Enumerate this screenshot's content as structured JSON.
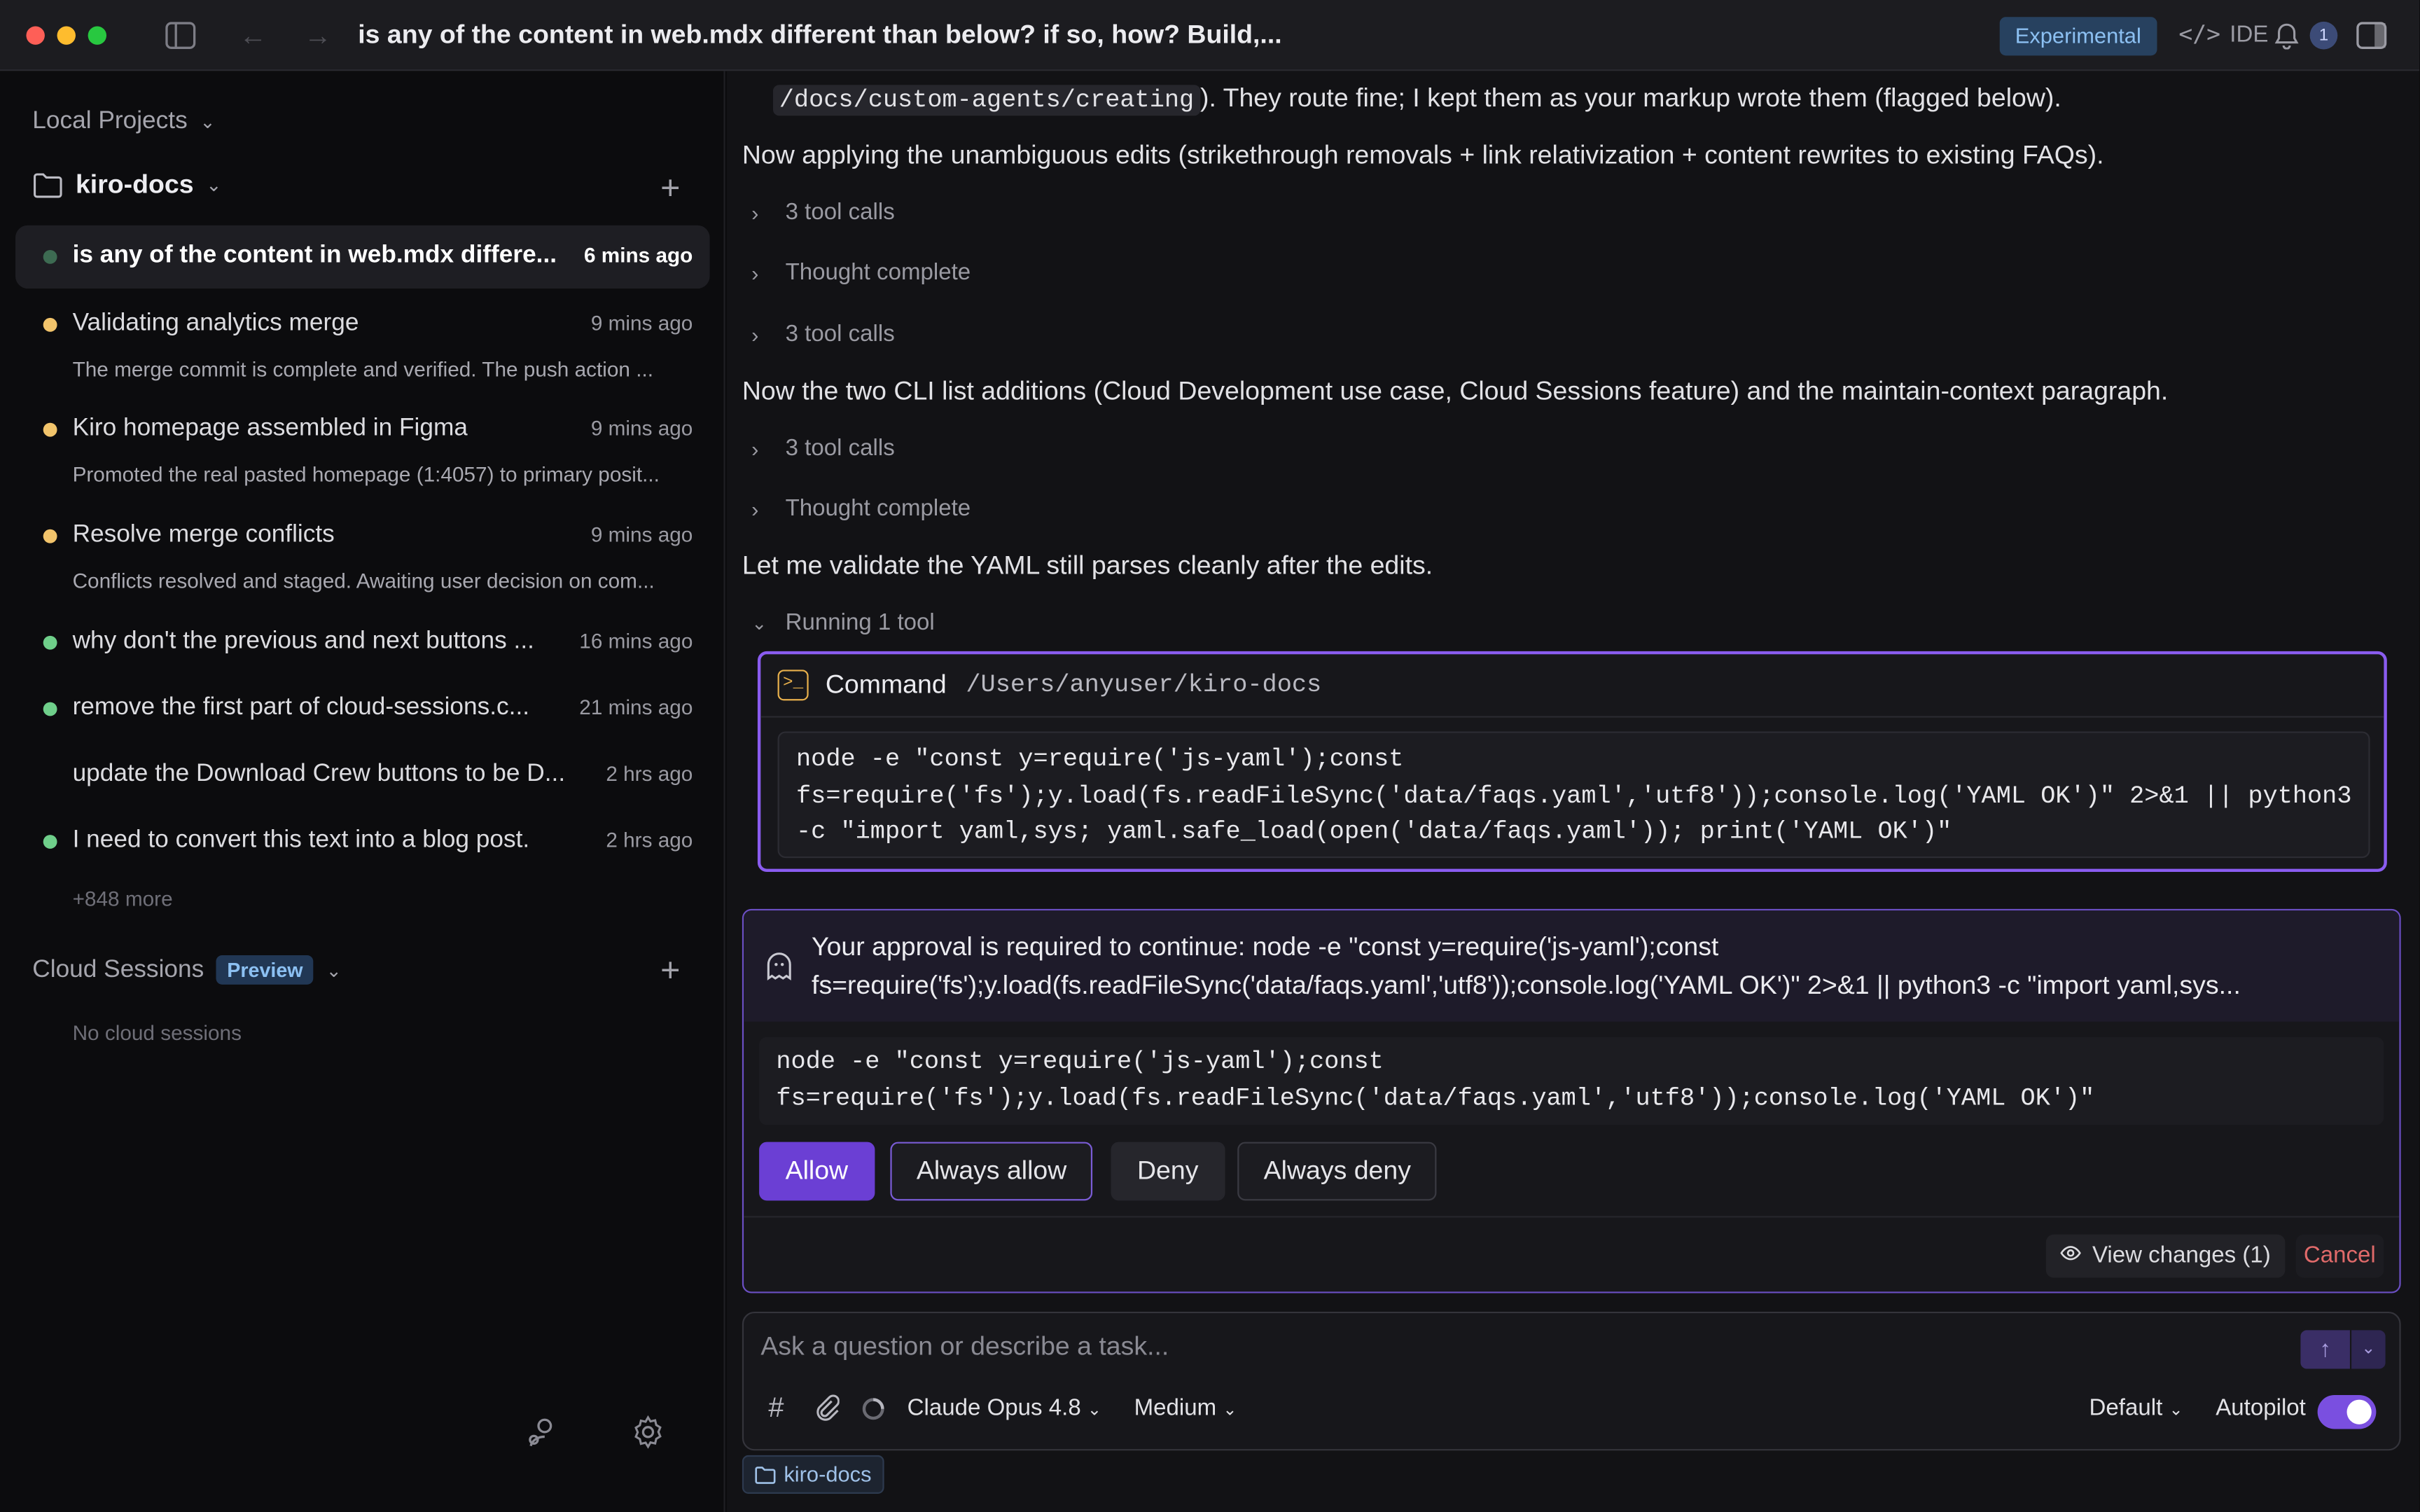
{
  "window": {
    "title": "is any of the content in web.mdx different than below? if so, how? Build,...",
    "experimental_badge": "Experimental",
    "ide_label": "IDE",
    "notification_count": "1"
  },
  "sidebar": {
    "local_projects": "Local Projects",
    "project_name": "kiro-docs",
    "sessions": [
      {
        "title": "is any of the content in web.mdx differe...",
        "time": "6 mins ago",
        "subtitle": "",
        "status_color": "#3d6b52",
        "active": true
      },
      {
        "title": "Validating analytics merge",
        "time": "9 mins ago",
        "subtitle": "The merge commit is complete and verified. The push action ...",
        "status_color": "#f2c46b"
      },
      {
        "title": "Kiro homepage assembled in Figma",
        "time": "9 mins ago",
        "subtitle": "Promoted the real pasted homepage (1:4057) to primary posit...",
        "status_color": "#f2c46b"
      },
      {
        "title": "Resolve merge conflicts",
        "time": "9 mins ago",
        "subtitle": "Conflicts resolved and staged. Awaiting user decision on com...",
        "status_color": "#f2c46b"
      },
      {
        "title": "why don't the previous and next buttons ...",
        "time": "16 mins ago",
        "subtitle": "",
        "status_color": "#6fcf8a"
      },
      {
        "title": "remove the first part of cloud-sessions.c...",
        "time": "21 mins ago",
        "subtitle": "",
        "status_color": "#6fcf8a"
      },
      {
        "title": "update the Download Crew buttons to be D...",
        "time": "2 hrs ago",
        "subtitle": "",
        "status_color": ""
      },
      {
        "title": "I need to convert this text into a blog post.",
        "time": "2 hrs ago",
        "subtitle": "",
        "status_color": "#6fcf8a"
      }
    ],
    "more": "+848 more",
    "cloud_sessions": "Cloud Sessions",
    "preview_badge": "Preview",
    "no_cloud": "No cloud sessions"
  },
  "chat": {
    "top_line_code": "/docs/custom-agents/creating",
    "top_line_rest": "). They route fine; I kept them as your markup wrote them (flagged below).",
    "msg1": "Now applying the unambiguous edits (strikethrough removals + link relativization + content rewrites to existing FAQs).",
    "tool_calls_1": "3 tool calls",
    "thought_1": "Thought complete",
    "tool_calls_2": "3 tool calls",
    "msg2": "Now the two CLI list additions (Cloud Development use case, Cloud Sessions feature) and the maintain-context paragraph.",
    "tool_calls_3": "3 tool calls",
    "thought_2": "Thought complete",
    "msg3": "Let me validate the YAML still parses cleanly after the edits.",
    "running": "Running 1 tool",
    "command": {
      "label": "Command",
      "path": "/Users/anyuser/kiro-docs",
      "code": "node -e \"const y=require('js-yaml');const\nfs=require('fs');y.load(fs.readFileSync('data/faqs.yaml','utf8'));console.log('YAML OK')\" 2>&1 || python3\n-c \"import yaml,sys; yaml.safe_load(open('data/faqs.yaml')); print('YAML OK')\""
    },
    "approval": {
      "text_line1": "Your approval is required to continue: node -e \"const y=require('js-yaml');const",
      "text_line2": "fs=require('fs');y.load(fs.readFileSync('data/faqs.yaml','utf8'));console.log('YAML OK')\" 2>&1 || python3 -c \"import yaml,sys...",
      "code": "node -e \"const y=require('js-yaml');const\nfs=require('fs');y.load(fs.readFileSync('data/faqs.yaml','utf8'));console.log('YAML OK')\"",
      "allow": "Allow",
      "always_allow": "Always allow",
      "deny": "Deny",
      "always_deny": "Always deny",
      "view_changes": "View changes (1)",
      "cancel": "Cancel"
    }
  },
  "composer": {
    "placeholder": "Ask a question or describe a task...",
    "model": "Claude Opus 4.8",
    "effort": "Medium",
    "mode": "Default",
    "autopilot": "Autopilot",
    "autopilot_on": true,
    "folder_chip": "kiro-docs"
  }
}
